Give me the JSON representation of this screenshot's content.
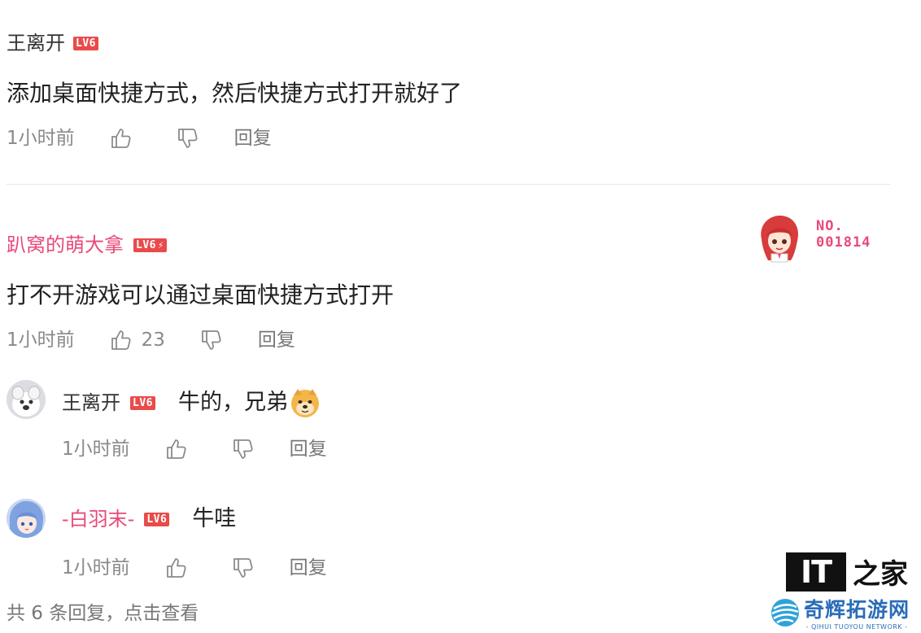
{
  "comment1": {
    "username": "王离开",
    "level": "LV6",
    "text": "添加桌面快捷方式，然后快捷方式打开就好了",
    "time": "1小时前",
    "like_icon": "thumbs-up-icon",
    "dislike_icon": "thumbs-down-icon",
    "reply_label": "回复"
  },
  "comment2": {
    "username": "趴窝的萌大拿",
    "level": "LV6",
    "level_extra": "⚡",
    "badge_no_label": "NO.",
    "badge_no_value": "001814",
    "text": "打不开游戏可以通过桌面快捷方式打开",
    "time": "1小时前",
    "like_count": "23",
    "reply_label": "回复"
  },
  "replies": [
    {
      "username": "王离开",
      "level": "LV6",
      "text": "牛的，兄弟",
      "emoji": "doge-emoji",
      "time": "1小时前",
      "reply_label": "回复"
    },
    {
      "username": "-白羽末-",
      "level": "LV6",
      "text": "牛哇",
      "time": "1小时前",
      "reply_label": "回复"
    }
  ],
  "more_replies": "共 6 条回复，点击查看",
  "watermark": {
    "logo_text": "IT",
    "logo_cn_char": "之家",
    "site_name_cn": "奇辉拓游网",
    "site_name_en": "- QIHUI TUOYOU NETWORK -"
  },
  "colors": {
    "accent_pink": "#e84a7a",
    "level_badge": "#e94b4b",
    "meta_gray": "#8a8a8a",
    "watermark_blue": "#2a6db8"
  }
}
